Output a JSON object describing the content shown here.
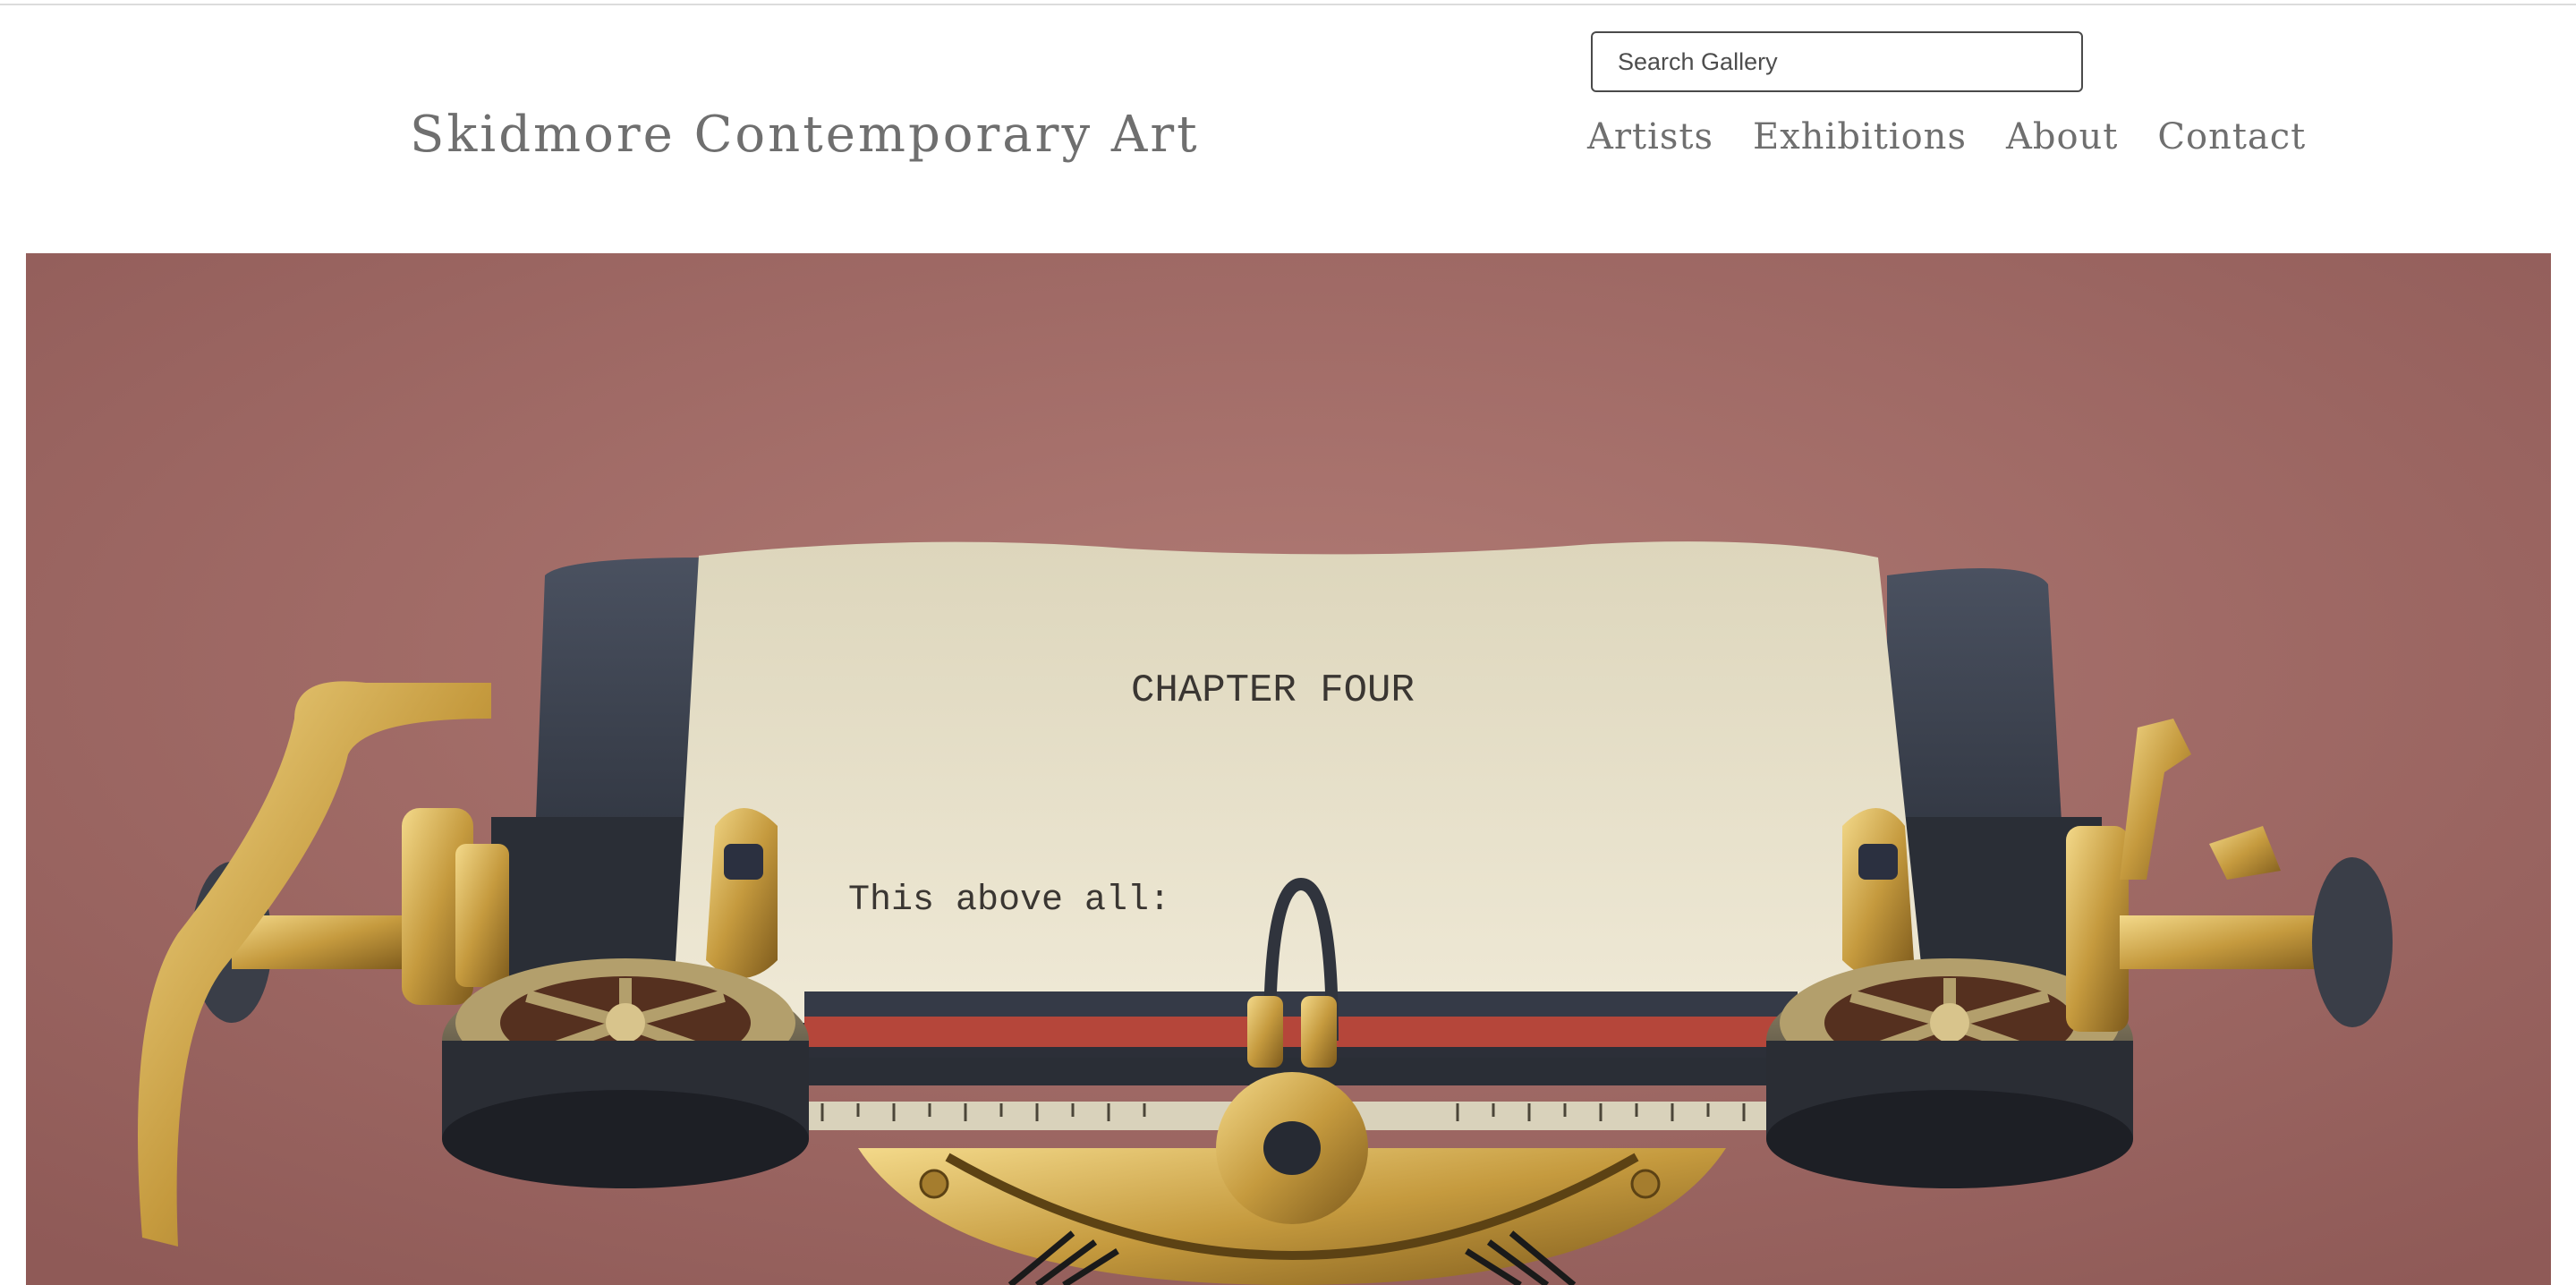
{
  "site": {
    "title": "Skidmore Contemporary Art"
  },
  "search": {
    "placeholder": "Search Gallery"
  },
  "nav": {
    "items": [
      {
        "label": "Artists"
      },
      {
        "label": "Exhibitions"
      },
      {
        "label": "About"
      },
      {
        "label": "Contact"
      }
    ]
  },
  "hero": {
    "paper_heading": "CHAPTER FOUR",
    "paper_line": "This above all:"
  },
  "colors": {
    "text_gray": "#6f6f6f",
    "background": "#ffffff",
    "hero_backdrop": "#9a6461",
    "paper": "#e8e2cc",
    "brass": "#c9a144"
  }
}
